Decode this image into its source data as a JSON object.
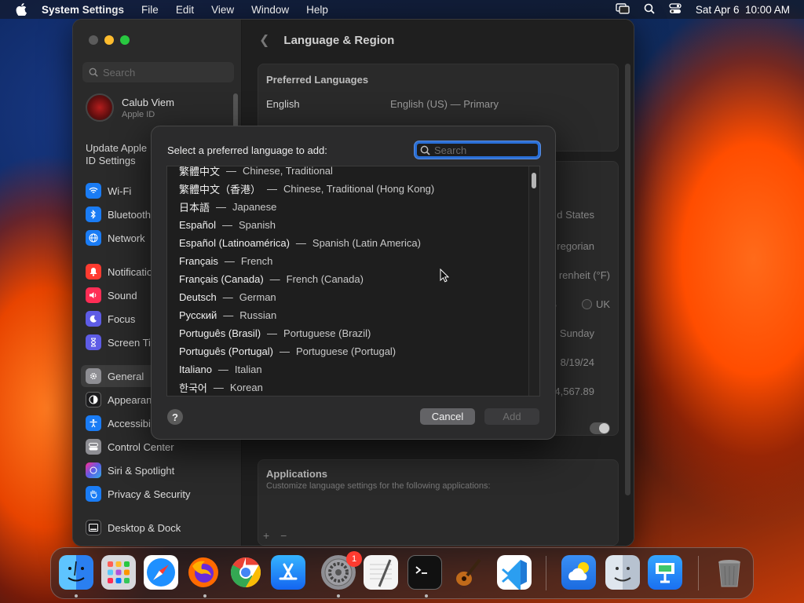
{
  "menubar": {
    "app_name": "System Settings",
    "items": [
      "File",
      "Edit",
      "View",
      "Window",
      "Help"
    ],
    "datetime": "Sat Apr 6  10:00 AM"
  },
  "sidebar": {
    "search_placeholder": "Search",
    "account": {
      "name": "Calub Viem",
      "subtitle": "Apple ID"
    },
    "update_label": "Update Apple ID Settings",
    "items": [
      {
        "label": "Wi-Fi",
        "icon": "wifi-icon",
        "color": "#1a7cf5"
      },
      {
        "label": "Bluetooth",
        "icon": "bluetooth-icon",
        "color": "#1a7cf5"
      },
      {
        "label": "Network",
        "icon": "globe-icon",
        "color": "#1a7cf5"
      },
      {
        "label": "Notifications",
        "icon": "bell-icon",
        "color": "#ff3b30"
      },
      {
        "label": "Sound",
        "icon": "speaker-icon",
        "color": "#ff2d55"
      },
      {
        "label": "Focus",
        "icon": "moon-icon",
        "color": "#5e5ce6"
      },
      {
        "label": "Screen Time",
        "icon": "hourglass-icon",
        "color": "#5e5ce6"
      },
      {
        "label": "General",
        "icon": "gear-icon",
        "color": "#8e8e93"
      },
      {
        "label": "Appearance",
        "icon": "appearance-icon",
        "color": "#1c1c1e"
      },
      {
        "label": "Accessibility",
        "icon": "accessibility-icon",
        "color": "#1a7cf5"
      },
      {
        "label": "Control Center",
        "icon": "control-center-icon",
        "color": "#8e8e93"
      },
      {
        "label": "Siri & Spotlight",
        "icon": "siri-icon",
        "color": "#bf5af2"
      },
      {
        "label": "Privacy & Security",
        "icon": "hand-icon",
        "color": "#1a7cf5"
      },
      {
        "label": "Desktop & Dock",
        "icon": "dock-icon",
        "color": "#1c1c1e"
      }
    ]
  },
  "content": {
    "title": "Language & Region",
    "preferred_title": "Preferred Languages",
    "preferred_lang": "English",
    "preferred_value": "English (US) — Primary",
    "settings_values": [
      "d States",
      "regorian",
      "renheit (°F)",
      "US",
      "UK",
      "Sunday",
      "8/19/24",
      "4,567.89"
    ],
    "applications_title": "Applications",
    "applications_desc": "Customize language settings for the following applications:"
  },
  "dialog": {
    "title": "Select a preferred language to add:",
    "search_placeholder": "Search",
    "languages": [
      {
        "native": "繁體中文",
        "english": "Chinese, Traditional"
      },
      {
        "native": "繁體中文（香港）",
        "english": "Chinese, Traditional (Hong Kong)"
      },
      {
        "native": "日本語",
        "english": "Japanese"
      },
      {
        "native": "Español",
        "english": "Spanish"
      },
      {
        "native": "Español (Latinoamérica)",
        "english": "Spanish (Latin America)"
      },
      {
        "native": "Français",
        "english": "French"
      },
      {
        "native": "Français (Canada)",
        "english": "French (Canada)"
      },
      {
        "native": "Deutsch",
        "english": "German"
      },
      {
        "native": "Русский",
        "english": "Russian"
      },
      {
        "native": "Português (Brasil)",
        "english": "Portuguese (Brazil)"
      },
      {
        "native": "Português (Portugal)",
        "english": "Portuguese (Portugal)"
      },
      {
        "native": "Italiano",
        "english": "Italian"
      },
      {
        "native": "한국어",
        "english": "Korean"
      }
    ],
    "separator": "—",
    "help_label": "?",
    "cancel_label": "Cancel",
    "add_label": "Add"
  },
  "dock": {
    "badge_count": "1",
    "apps": [
      {
        "name": "finder-icon",
        "color": "#2c8cf0"
      },
      {
        "name": "launchpad-icon",
        "color": "#d8d8dc"
      },
      {
        "name": "safari-icon",
        "color": "#1e90ff"
      },
      {
        "name": "firefox-icon",
        "color": "#ff6a00"
      },
      {
        "name": "chrome-icon",
        "color": "#ffffff"
      },
      {
        "name": "app-store-icon",
        "color": "#1a8cff"
      },
      {
        "name": "system-settings-icon",
        "color": "#8e8e93"
      },
      {
        "name": "textedit-icon",
        "color": "#f4f4f4"
      },
      {
        "name": "terminal-icon",
        "color": "#1a1a1a"
      },
      {
        "name": "garageband-icon",
        "color": "#6a3a10"
      },
      {
        "name": "vscode-icon",
        "color": "#ffffff"
      },
      {
        "name": "weather-icon",
        "color": "#3d8cf5"
      },
      {
        "name": "finder-alt-icon",
        "color": "#c9d3e0"
      },
      {
        "name": "keynote-icon",
        "color": "#1a8cff"
      },
      {
        "name": "trash-icon",
        "color": "#7a7a7a"
      }
    ]
  }
}
